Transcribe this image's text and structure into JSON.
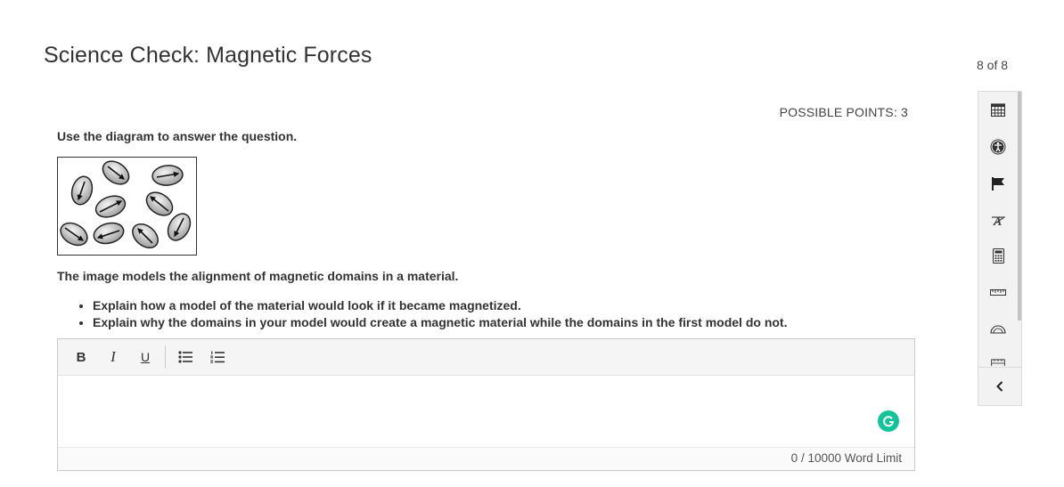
{
  "header": {
    "title": "Science Check: Magnetic Forces",
    "counter": "8 of 8"
  },
  "question": {
    "points": "POSSIBLE POINTS: 3",
    "prompt": "Use the diagram to answer the question.",
    "description": "The image models the alignment of magnetic domains in a material.",
    "bullets": [
      "Explain how a model of the material would look if it became magnetized.",
      "Explain why the domains in your model would create a magnetic material while the domains in the first model do not."
    ]
  },
  "editor": {
    "toolbar": {
      "bold": "B",
      "italic": "I",
      "underline": "U",
      "bullet_list_icon": "bullet-list-icon",
      "numbered_list_icon": "numbered-list-icon"
    },
    "value": "",
    "word_count": "0",
    "word_limit": " / 10000 Word Limit",
    "grammarly_icon": "grammarly-icon"
  },
  "tools": [
    "calendar-icon",
    "accessibility-icon",
    "flag-icon",
    "strikethrough-a-icon",
    "calculator-icon",
    "ruler-icon",
    "protractor-icon",
    "calendar-icon",
    "chevron-left-icon"
  ]
}
